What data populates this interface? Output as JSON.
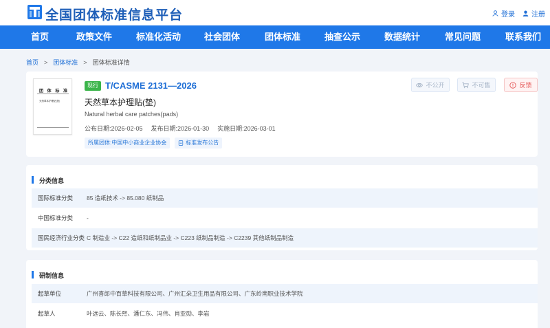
{
  "header": {
    "site_title": "全国团体标准信息平台",
    "login_label": "登录",
    "register_label": "注册"
  },
  "nav": {
    "items": [
      "首页",
      "政策文件",
      "标准化活动",
      "社会团体",
      "团体标准",
      "抽查公示",
      "数据统计",
      "常见问题",
      "联系我们"
    ]
  },
  "breadcrumb": {
    "items": [
      "首页",
      "团体标准",
      "团体标准详情"
    ],
    "separator": ">"
  },
  "standard": {
    "status": "现行",
    "number": "T/CASME 2131—2026",
    "name_cn": "天然草本护理贴(垫)",
    "name_en": "Natural herbal care patches(pads)",
    "publish_date": "公布日期:2026-02-05",
    "issue_date": "发布日期:2026-01-30",
    "effective_date": "实施日期:2026-03-01",
    "org_tag": "所属团体:中国中小商业企业协会",
    "notice_tag": "标准发布公告",
    "thumbnail": {
      "title": "团 体 标 准",
      "name": "天然草本护理贴(垫)"
    }
  },
  "actions": {
    "private_label": "不公开",
    "nosale_label": "不可售",
    "feedback_label": "反馈"
  },
  "classify": {
    "title": "分类信息",
    "rows": [
      {
        "key": "国际标准分类",
        "value": "85 造纸技术 -> 85.080 纸制品"
      },
      {
        "key": "中国标准分类",
        "value": "-"
      },
      {
        "key": "国民经济行业分类",
        "value": "C 制造业 -> C22 造纸和纸制品业 -> C223 纸制品制造 -> C2239 其他纸制品制造"
      }
    ]
  },
  "research": {
    "title": "研制信息",
    "rows": [
      {
        "key": "起草单位",
        "value": "广州喜郎中百草科技有限公司、广州汇朵卫生用品有限公司、广东岭南职业技术学院"
      },
      {
        "key": "起草人",
        "value": "叶远云、陈长熙、潘仁东、冯伟、肖亚勋、李岩"
      }
    ]
  },
  "colors": {
    "primary": "#1f78e8",
    "status_green": "#3bb54a",
    "feedback_red": "#e45656"
  }
}
